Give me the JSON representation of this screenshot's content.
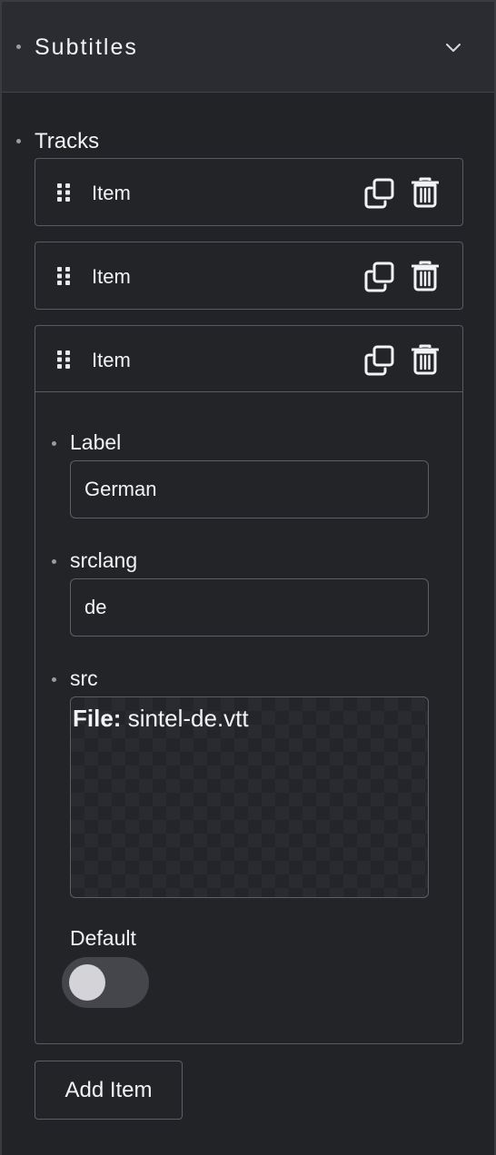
{
  "header": {
    "title": "Subtitles",
    "expand_icon": "chevron-down-icon"
  },
  "tracks": {
    "label": "Tracks",
    "items": [
      {
        "label": "Item",
        "expanded": false
      },
      {
        "label": "Item",
        "expanded": false
      },
      {
        "label": "Item",
        "expanded": true,
        "fields": {
          "label": {
            "label": "Label",
            "value": "German"
          },
          "srclang": {
            "label": "srclang",
            "value": "de"
          },
          "src": {
            "label": "src",
            "file_prefix": "File:",
            "file_name": "sintel-de.vtt"
          },
          "default": {
            "label": "Default",
            "checked": false
          }
        }
      }
    ],
    "add_label": "Add Item"
  },
  "icons": {
    "drag": "drag-handle-icon",
    "duplicate": "duplicate-icon",
    "delete": "trash-icon"
  },
  "colors": {
    "panel_bg": "#222327",
    "header_bg": "#2b2c31",
    "border": "#5a5b62",
    "text": "#f2f3f5"
  }
}
